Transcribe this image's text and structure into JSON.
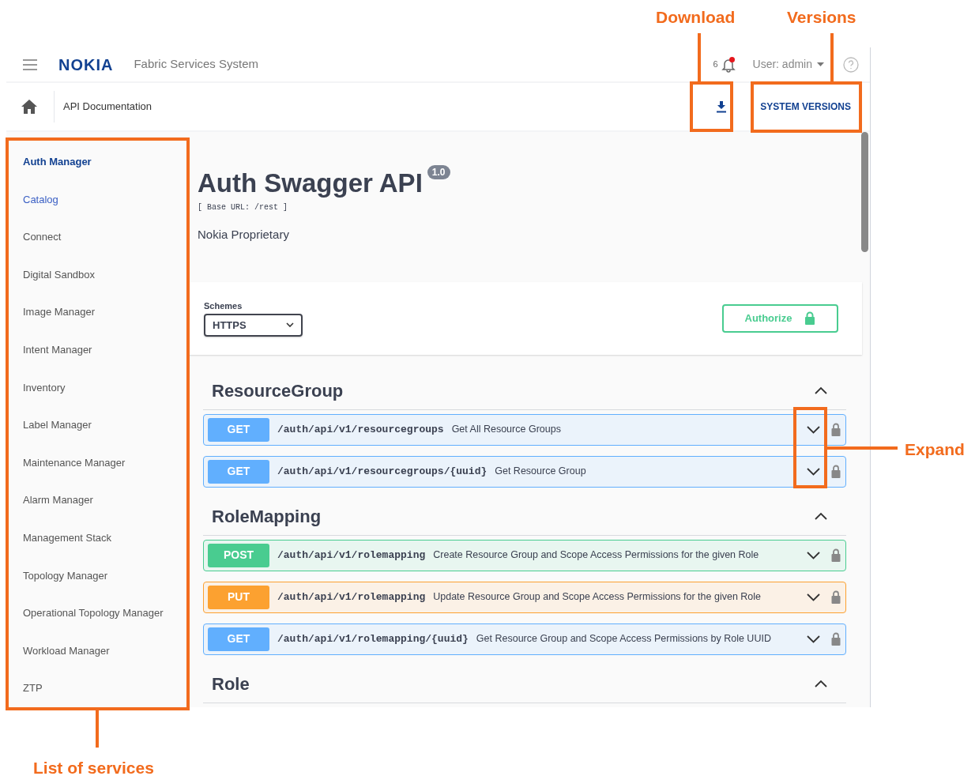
{
  "header": {
    "logo": "NOKIA",
    "app_name": "Fabric Services System",
    "notification_count": "6",
    "unread": true,
    "user": "User: admin"
  },
  "breadcrumb": {
    "page": "API Documentation",
    "system_versions": "SYSTEM VERSIONS"
  },
  "sidebar": {
    "items": [
      {
        "label": "Auth Manager",
        "selected": true,
        "hovered": false
      },
      {
        "label": "Catalog",
        "selected": false,
        "hovered": true
      },
      {
        "label": "Connect",
        "selected": false,
        "hovered": false
      },
      {
        "label": "Digital Sandbox",
        "selected": false,
        "hovered": false
      },
      {
        "label": "Image Manager",
        "selected": false,
        "hovered": false
      },
      {
        "label": "Intent Manager",
        "selected": false,
        "hovered": false
      },
      {
        "label": "Inventory",
        "selected": false,
        "hovered": false
      },
      {
        "label": "Label Manager",
        "selected": false,
        "hovered": false
      },
      {
        "label": "Maintenance Manager",
        "selected": false,
        "hovered": false
      },
      {
        "label": "Alarm Manager",
        "selected": false,
        "hovered": false
      },
      {
        "label": "Management Stack",
        "selected": false,
        "hovered": false
      },
      {
        "label": "Topology Manager",
        "selected": false,
        "hovered": false
      },
      {
        "label": "Operational Topology Manager",
        "selected": false,
        "hovered": false
      },
      {
        "label": "Workload Manager",
        "selected": false,
        "hovered": false
      },
      {
        "label": "ZTP",
        "selected": false,
        "hovered": false
      }
    ]
  },
  "api": {
    "title": "Auth Swagger API",
    "version": "1.0",
    "base_url": "[ Base URL: /rest ]",
    "description": "Nokia Proprietary",
    "schemes_label": "Schemes",
    "scheme": "HTTPS",
    "authorize": "Authorize"
  },
  "sections": [
    {
      "name": "ResourceGroup",
      "expanded": true,
      "operations": [
        {
          "kind": "get",
          "method": "GET",
          "path": "/auth/api/v1/resourcegroups",
          "summary": "Get All Resource Groups"
        },
        {
          "kind": "get",
          "method": "GET",
          "path": "/auth/api/v1/resourcegroups/{uuid}",
          "summary": "Get Resource Group"
        }
      ]
    },
    {
      "name": "RoleMapping",
      "expanded": true,
      "operations": [
        {
          "kind": "post",
          "method": "POST",
          "path": "/auth/api/v1/rolemapping",
          "summary": "Create Resource Group and Scope Access Permissions for the given Role"
        },
        {
          "kind": "put",
          "method": "PUT",
          "path": "/auth/api/v1/rolemapping",
          "summary": "Update Resource Group and Scope Access Permissions for the given Role"
        },
        {
          "kind": "get",
          "method": "GET",
          "path": "/auth/api/v1/rolemapping/{uuid}",
          "summary": "Get Resource Group and Scope Access Permissions by Role UUID"
        }
      ]
    },
    {
      "name": "Role",
      "expanded": true
    }
  ],
  "annotations": [
    {
      "kind": "download",
      "label": "Download"
    },
    {
      "kind": "versions",
      "label": "Versions"
    },
    {
      "kind": "expand",
      "label": "Expand"
    },
    {
      "kind": "services",
      "label": "List of services"
    }
  ]
}
